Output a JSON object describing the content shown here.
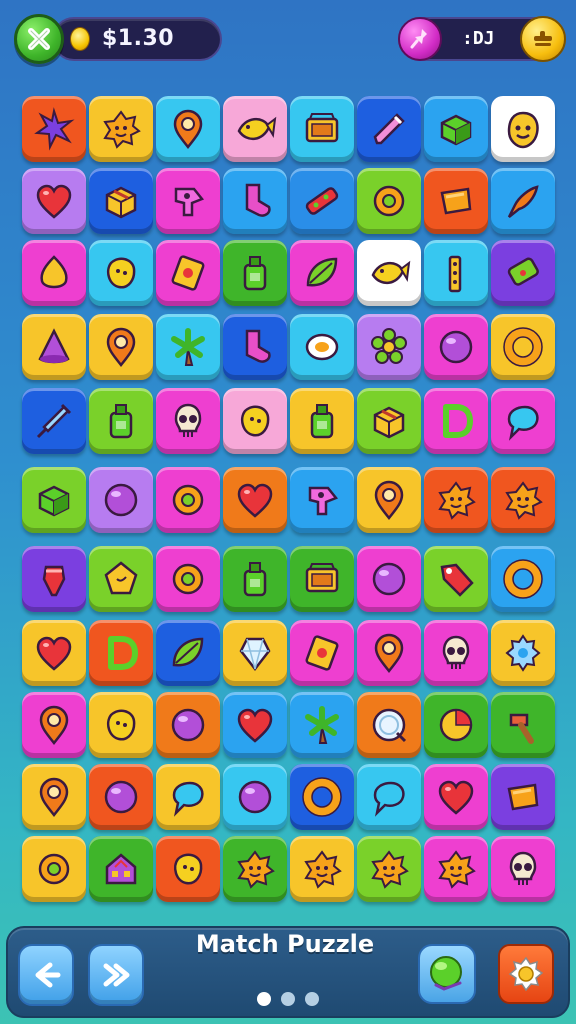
{
  "header": {
    "close_icon": "close-x-icon",
    "coin_icon": "coin-icon",
    "coins": "$1.30",
    "pin_icon": "pin-icon",
    "right_value": ":DJ",
    "gold_button_icon": "plus-icon"
  },
  "board": {
    "rows": 11,
    "cols": 8,
    "tiles": [
      [
        "#f0561f",
        "star"
      ],
      [
        "#f7c52a",
        "burst"
      ],
      [
        "#37c7f0",
        "pin"
      ],
      [
        "#f7a8d8",
        "fish"
      ],
      [
        "#37c7f0",
        "crate"
      ],
      [
        "#1e5fe0",
        "pencil"
      ],
      [
        "#2ba3f0",
        "cube"
      ],
      [
        "#ffffff",
        "face"
      ],
      [
        "#b77cf0",
        "heart"
      ],
      [
        "#1e5fe0",
        "box"
      ],
      [
        "#ee3fd0",
        "arrow"
      ],
      [
        "#2ba3f0",
        "sock"
      ],
      [
        "#2a8ee8",
        "wrench"
      ],
      [
        "#7ad12a",
        "ring"
      ],
      [
        "#f0561f",
        "wedge"
      ],
      [
        "#2ba3f0",
        "pointer"
      ],
      [
        "#ee3fd0",
        "drop"
      ],
      [
        "#37c7f0",
        "blob"
      ],
      [
        "#ee3fd0",
        "card"
      ],
      [
        "#3fb52a",
        "bottle"
      ],
      [
        "#ee3fd0",
        "leaf"
      ],
      [
        "#ffffff",
        "fish"
      ],
      [
        "#37c7f0",
        "ladder"
      ],
      [
        "#7b3fe0",
        "chip"
      ],
      [
        "#f7c52a",
        "cone"
      ],
      [
        "#f7c52a",
        "pin"
      ],
      [
        "#37c7f0",
        "palm"
      ],
      [
        "#1e5fe0",
        "sock"
      ],
      [
        "#37c7f0",
        "egg"
      ],
      [
        "#b77cf0",
        "flower"
      ],
      [
        "#ee3fd0",
        "orb"
      ],
      [
        "#f7c52a",
        "donut"
      ],
      [
        "#1e5fe0",
        "syringe"
      ],
      [
        "#7ad12a",
        "bottle"
      ],
      [
        "#ee3fd0",
        "skull"
      ],
      [
        "#f7a8d8",
        "blob"
      ],
      [
        "#f7c52a",
        "bottle"
      ],
      [
        "#7ad12a",
        "box"
      ],
      [
        "#ee3fd0",
        "d"
      ],
      [
        "#ee3fd0",
        "speech"
      ],
      [
        "#7ad12a",
        "cube"
      ],
      [
        "#b77cf0",
        "orb"
      ],
      [
        "#ee3fd0",
        "ring"
      ],
      [
        "#f07a1a",
        "heart"
      ],
      [
        "#2ba3f0",
        "arrow"
      ],
      [
        "#f7c52a",
        "pin"
      ],
      [
        "#f0561f",
        "burst"
      ],
      [
        "#f0561f",
        "burst"
      ],
      [
        "#7b3fe0",
        "ice"
      ],
      [
        "#7ad12a",
        "pentagon"
      ],
      [
        "#ee3fd0",
        "ring"
      ],
      [
        "#3fb52a",
        "bottle"
      ],
      [
        "#3fb52a",
        "crate"
      ],
      [
        "#ee3fd0",
        "orb"
      ],
      [
        "#7ad12a",
        "tag"
      ],
      [
        "#2ba3f0",
        "donut"
      ],
      [
        "#f7c52a",
        "heart"
      ],
      [
        "#f0561f",
        "d"
      ],
      [
        "#1e5fe0",
        "leaf"
      ],
      [
        "#f7c52a",
        "crystal"
      ],
      [
        "#ee3fd0",
        "card"
      ],
      [
        "#ee3fd0",
        "pin"
      ],
      [
        "#ee3fd0",
        "skull"
      ],
      [
        "#f7c52a",
        "gear"
      ],
      [
        "#ee3fd0",
        "pin"
      ],
      [
        "#f7c52a",
        "blob"
      ],
      [
        "#f07a1a",
        "orb"
      ],
      [
        "#2ba3f0",
        "heart"
      ],
      [
        "#2ba3f0",
        "palm"
      ],
      [
        "#f07a1a",
        "plate"
      ],
      [
        "#3fb52a",
        "pie"
      ],
      [
        "#3fb52a",
        "hammer"
      ],
      [
        "#f7c52a",
        "pin"
      ],
      [
        "#f0561f",
        "orb"
      ],
      [
        "#f7c52a",
        "speech"
      ],
      [
        "#37c7f0",
        "orb"
      ],
      [
        "#1e5fe0",
        "donut"
      ],
      [
        "#37c7f0",
        "speech"
      ],
      [
        "#ee3fd0",
        "heart"
      ],
      [
        "#7b3fe0",
        "wedge"
      ],
      [
        "#f7c52a",
        "ring"
      ],
      [
        "#3fb52a",
        "house"
      ],
      [
        "#f0561f",
        "blob"
      ],
      [
        "#3fb52a",
        "burst"
      ],
      [
        "#f7c52a",
        "burst"
      ],
      [
        "#7ad12a",
        "burst"
      ],
      [
        "#ee3fd0",
        "burst"
      ],
      [
        "#ee3fd0",
        "skull"
      ]
    ]
  },
  "footer": {
    "back_icon": "back-arrow-icon",
    "skip_icon": "skip-icon",
    "title": "Match Puzzle",
    "page_dots": 3,
    "active_dot": 0,
    "orb_icon": "green-orb-icon",
    "settings_icon": "gear-icon"
  }
}
